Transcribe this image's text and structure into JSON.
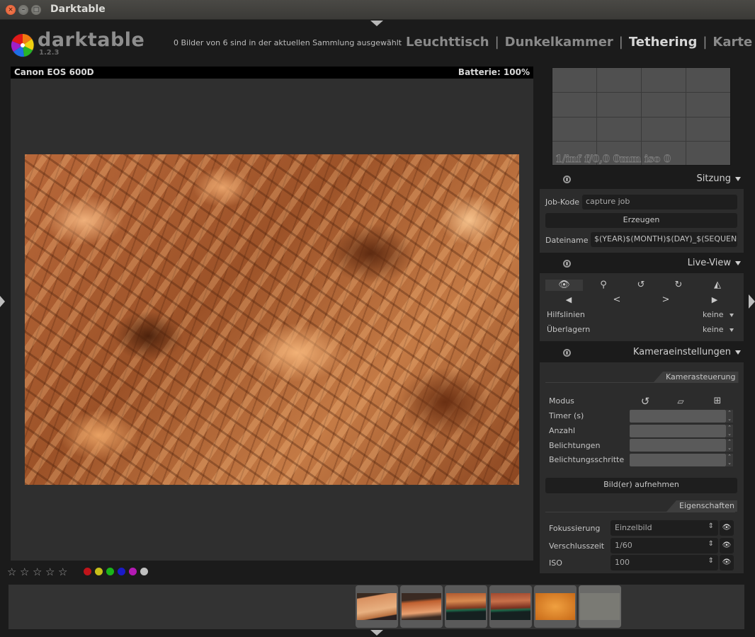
{
  "window": {
    "title": "Darktable",
    "controls": [
      "close",
      "minimize",
      "maximize"
    ]
  },
  "header": {
    "brand": "darktable",
    "version": "1.2.3",
    "selection_info": "0 Bilder von 6 sind in der aktuellen Sammlung ausgewählt",
    "views": [
      {
        "label": "Leuchttisch",
        "active": false
      },
      {
        "label": "Dunkelkammer",
        "active": false
      },
      {
        "label": "Tethering",
        "active": true
      },
      {
        "label": "Karte",
        "active": false
      }
    ],
    "separator": "|"
  },
  "center": {
    "camera_name": "Canon EOS 600D",
    "battery": "Batterie: 100%"
  },
  "bottom_bar": {
    "stars": 5,
    "rating": 0,
    "color_labels": [
      {
        "name": "red",
        "color": "#c0141a"
      },
      {
        "name": "yellow",
        "color": "#c8c01a"
      },
      {
        "name": "green",
        "color": "#1ab41a"
      },
      {
        "name": "blue",
        "color": "#1a1ac8"
      },
      {
        "name": "purple",
        "color": "#b41ab4"
      },
      {
        "name": "gray",
        "color": "#c0c0c0"
      }
    ]
  },
  "filmstrip": {
    "thumbnails": [
      {
        "ext": "jpg",
        "tone": "light-copper"
      },
      {
        "ext": "jpg",
        "tone": "copper-dark"
      },
      {
        "ext": "jpg",
        "tone": "copper-green"
      },
      {
        "ext": "jpg",
        "tone": "copper-green"
      },
      {
        "ext": "jpg",
        "tone": "orange"
      },
      {
        "ext": "jpg",
        "tone": "gray"
      }
    ]
  },
  "navigation": {
    "exif": "1/inf f/0,0 0mm iso 0"
  },
  "modules": {
    "session": {
      "title": "Sitzung",
      "job_code_label": "Job-Kode",
      "job_code_value": "capture job",
      "create_button": "Erzeugen",
      "filename_label": "Dateiname",
      "filename_value": "$(YEAR)$(MONTH)$(DAY)_$(SEQUENCE)"
    },
    "live_view": {
      "title": "Live-View",
      "icons": [
        "eye-icon",
        "zoom-icon",
        "rotate-left-icon",
        "rotate-right-icon",
        "flip-icon"
      ],
      "nav": [
        "◀",
        "<",
        ">",
        "▶"
      ],
      "guides_label": "Hilfslinien",
      "guides_value": "keine",
      "overlay_label": "Überlagern",
      "overlay_value": "keine"
    },
    "camera_settings": {
      "title": "Kameraeinstellungen",
      "control_section": "Kamerasteuerung",
      "mode_label": "Modus",
      "timer_label": "Timer (s)",
      "count_label": "Anzahl",
      "exposures_label": "Belichtungen",
      "exposure_steps_label": "Belichtungsschritte",
      "capture_button": "Bild(er) aufnehmen",
      "properties_section": "Eigenschaften",
      "properties": [
        {
          "label": "Fokussierung",
          "value": "Einzelbild"
        },
        {
          "label": "Verschlusszeit",
          "value": "1/60"
        },
        {
          "label": "ISO",
          "value": "100"
        }
      ]
    }
  }
}
